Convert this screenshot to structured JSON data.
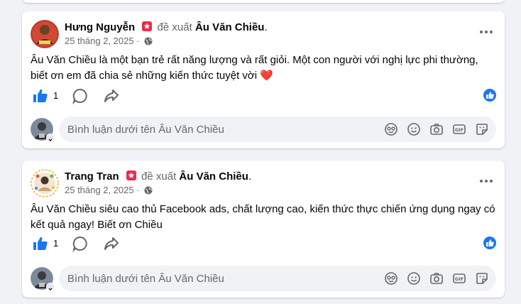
{
  "posts": [
    {
      "author": "Hưng Nguyễn",
      "action": "đề xuất",
      "target": "Âu Văn Chiều",
      "period": ".",
      "date": "25 tháng 2, 2025 ·",
      "text": "Âu Văn Chiều là một bạn trẻ rất năng lượng và rất giỏi. Một con người với nghị lực phi thường, biết ơn em đã chia sẻ những kiến thức tuyệt vời",
      "heart": "❤️",
      "like_count": "1",
      "comment_placeholder": "Bình luận dưới tên Âu Văn Chiều"
    },
    {
      "author": "Trang Tran",
      "action": "đề xuất",
      "target": "Âu Văn Chiều",
      "period": ".",
      "date": "25 tháng 2, 2025 ·",
      "text": "Âu Văn Chiều siêu cao thủ Facebook ads, chất lượng cao, kiến thức thực chiến ứng dụng ngay có kết quả ngay! Biết ơn Chiều",
      "like_count": "1",
      "comment_placeholder": "Bình luận dưới tên Âu Văn Chiều"
    }
  ],
  "colors": {
    "like_blue": "#1877f2",
    "recommend_red": "#f02849",
    "muted": "#65676b",
    "page_bg": "#f0f2f5"
  },
  "icons": [
    "recommend-badge-icon",
    "globe-icon",
    "more-options-icon",
    "like-icon",
    "comment-icon",
    "share-icon",
    "like-reaction-icon",
    "sticker-face-icon",
    "emoji-icon",
    "camera-icon",
    "gif-icon",
    "sticker-icon"
  ]
}
